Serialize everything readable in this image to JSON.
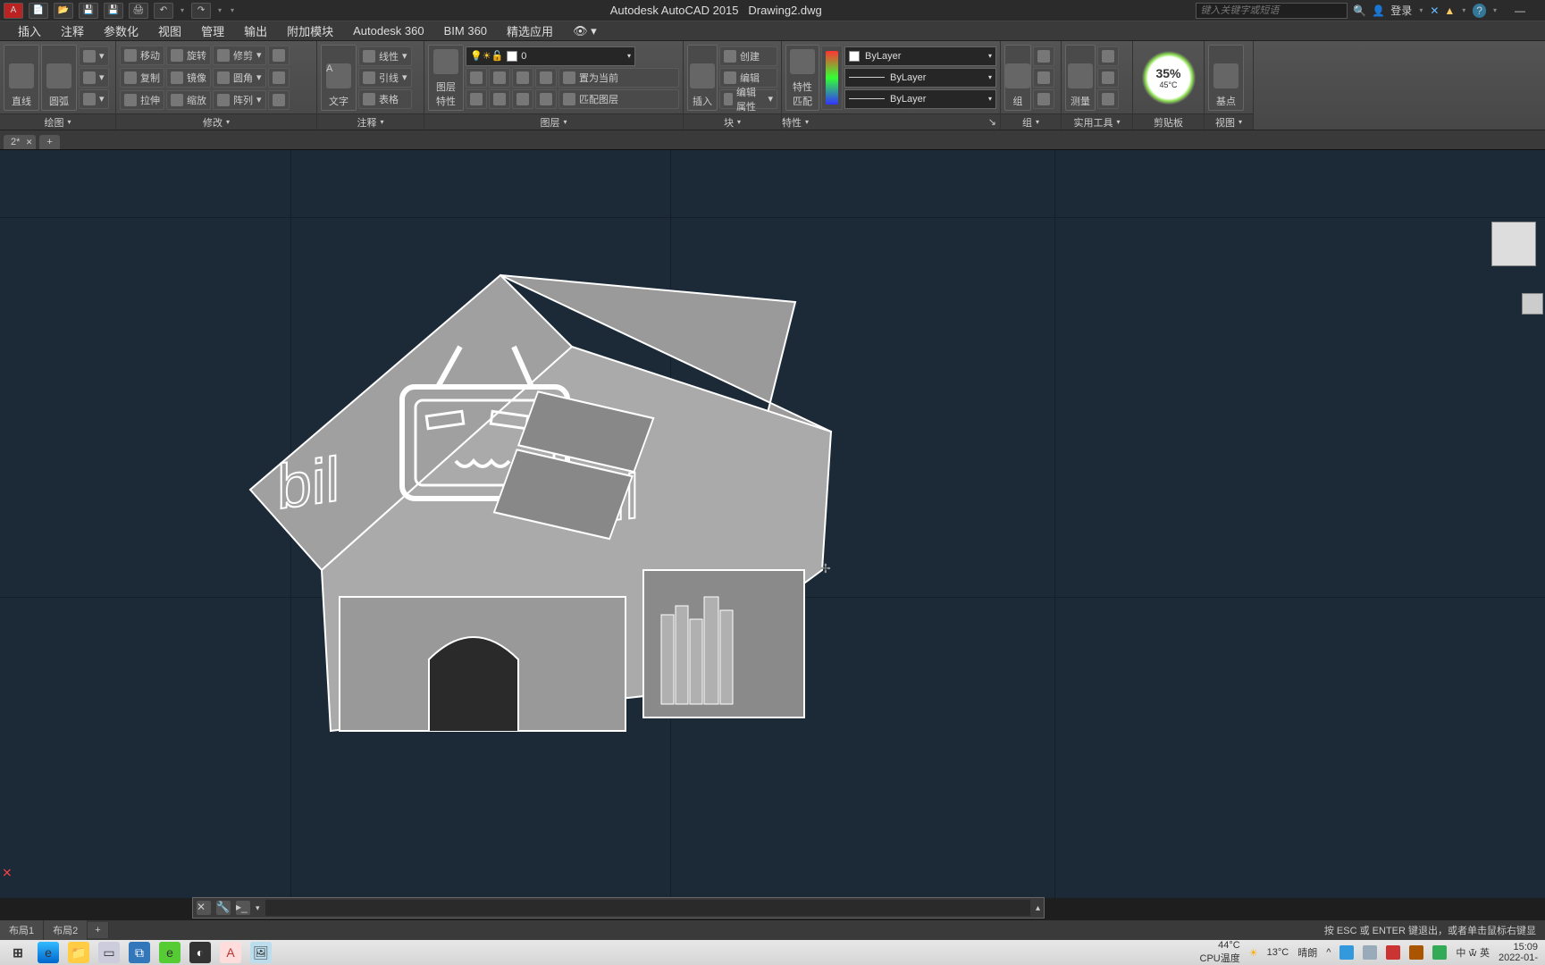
{
  "title": {
    "app": "Autodesk AutoCAD 2015",
    "file": "Drawing2.dwg"
  },
  "search_placeholder": "键入关键字或短语",
  "login": "登录",
  "ribbon_tabs": [
    "插入",
    "注释",
    "参数化",
    "视图",
    "管理",
    "输出",
    "附加模块",
    "Autodesk 360",
    "BIM 360",
    "精选应用"
  ],
  "panels": {
    "draw": {
      "title": "绘图",
      "big1": "直线",
      "big2": "圆弧"
    },
    "modify": {
      "title": "修改",
      "r1": [
        "移动",
        "旋转",
        "修剪"
      ],
      "r2": [
        "复制",
        "镜像",
        "圆角"
      ],
      "r3": [
        "拉伸",
        "缩放",
        "阵列"
      ]
    },
    "annot": {
      "title": "注释",
      "big": "文字",
      "r": [
        "线性",
        "引线",
        "表格"
      ]
    },
    "layers": {
      "title": "图层",
      "big": "图层\n特性",
      "combo": "0",
      "btns": [
        "置为当前",
        "匹配图层"
      ]
    },
    "block": {
      "title": "块",
      "big": "插入",
      "btns": [
        "创建",
        "编辑",
        "编辑属性"
      ]
    },
    "props": {
      "title": "特性",
      "big": "特性\n匹配",
      "dd": [
        "ByLayer",
        "ByLayer",
        "ByLayer"
      ]
    },
    "group": {
      "title": "组",
      "big": "组"
    },
    "util": {
      "title": "实用工具",
      "big": "测量"
    },
    "clip": {
      "title": "剪贴板"
    },
    "view": {
      "title": "视图",
      "big": "基点"
    }
  },
  "dial": {
    "main": "35%",
    "sub": "45°C"
  },
  "doctab": "2*",
  "layout_tabs": [
    "布局1",
    "布局2"
  ],
  "escape_hint": "按 ESC 或 ENTER 键退出，或者单击鼠标右键显",
  "taskbar": {
    "temp1": "44°C",
    "temp1_label": "CPU温度",
    "weather_temp": "13°C",
    "weather_cond": "晴朗",
    "ime": "中 🝃 英",
    "time": "15:09",
    "date": "2022-01-"
  }
}
